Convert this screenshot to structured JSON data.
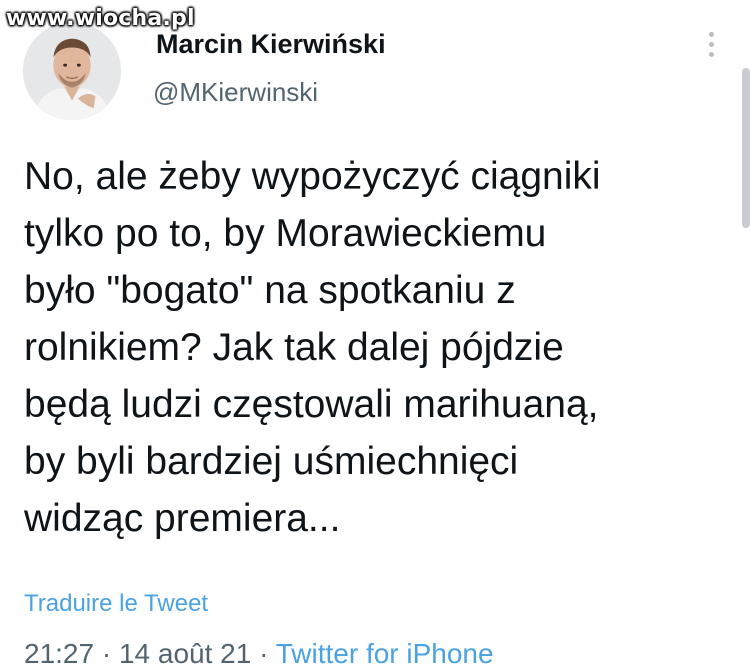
{
  "watermark": "www.wiocha.pl",
  "author": {
    "name": "Marcin Kierwiński",
    "handle": "@MKierwinski"
  },
  "tweet": {
    "lines": [
      "No, ale żeby wypożyczyć ciągniki",
      "tylko po to, by Morawieckiemu",
      "było \"bogato\" na spotkaniu z",
      "rolnikiem? Jak tak dalej pójdzie",
      "będą ludzi częstowali marihuaną,",
      "by byli bardziej uśmiechnięci",
      "widząc premiera..."
    ]
  },
  "translate_label": "Traduire le Tweet",
  "meta": {
    "time": "21:27",
    "sep1": " · ",
    "date": "14 août 21",
    "sep2": " · ",
    "source": "Twitter for iPhone"
  },
  "colors": {
    "text": "#0f1419",
    "muted": "#536471",
    "link": "#4aa2e3"
  },
  "icons": [
    "avatar-photo",
    "more-options-icon"
  ]
}
